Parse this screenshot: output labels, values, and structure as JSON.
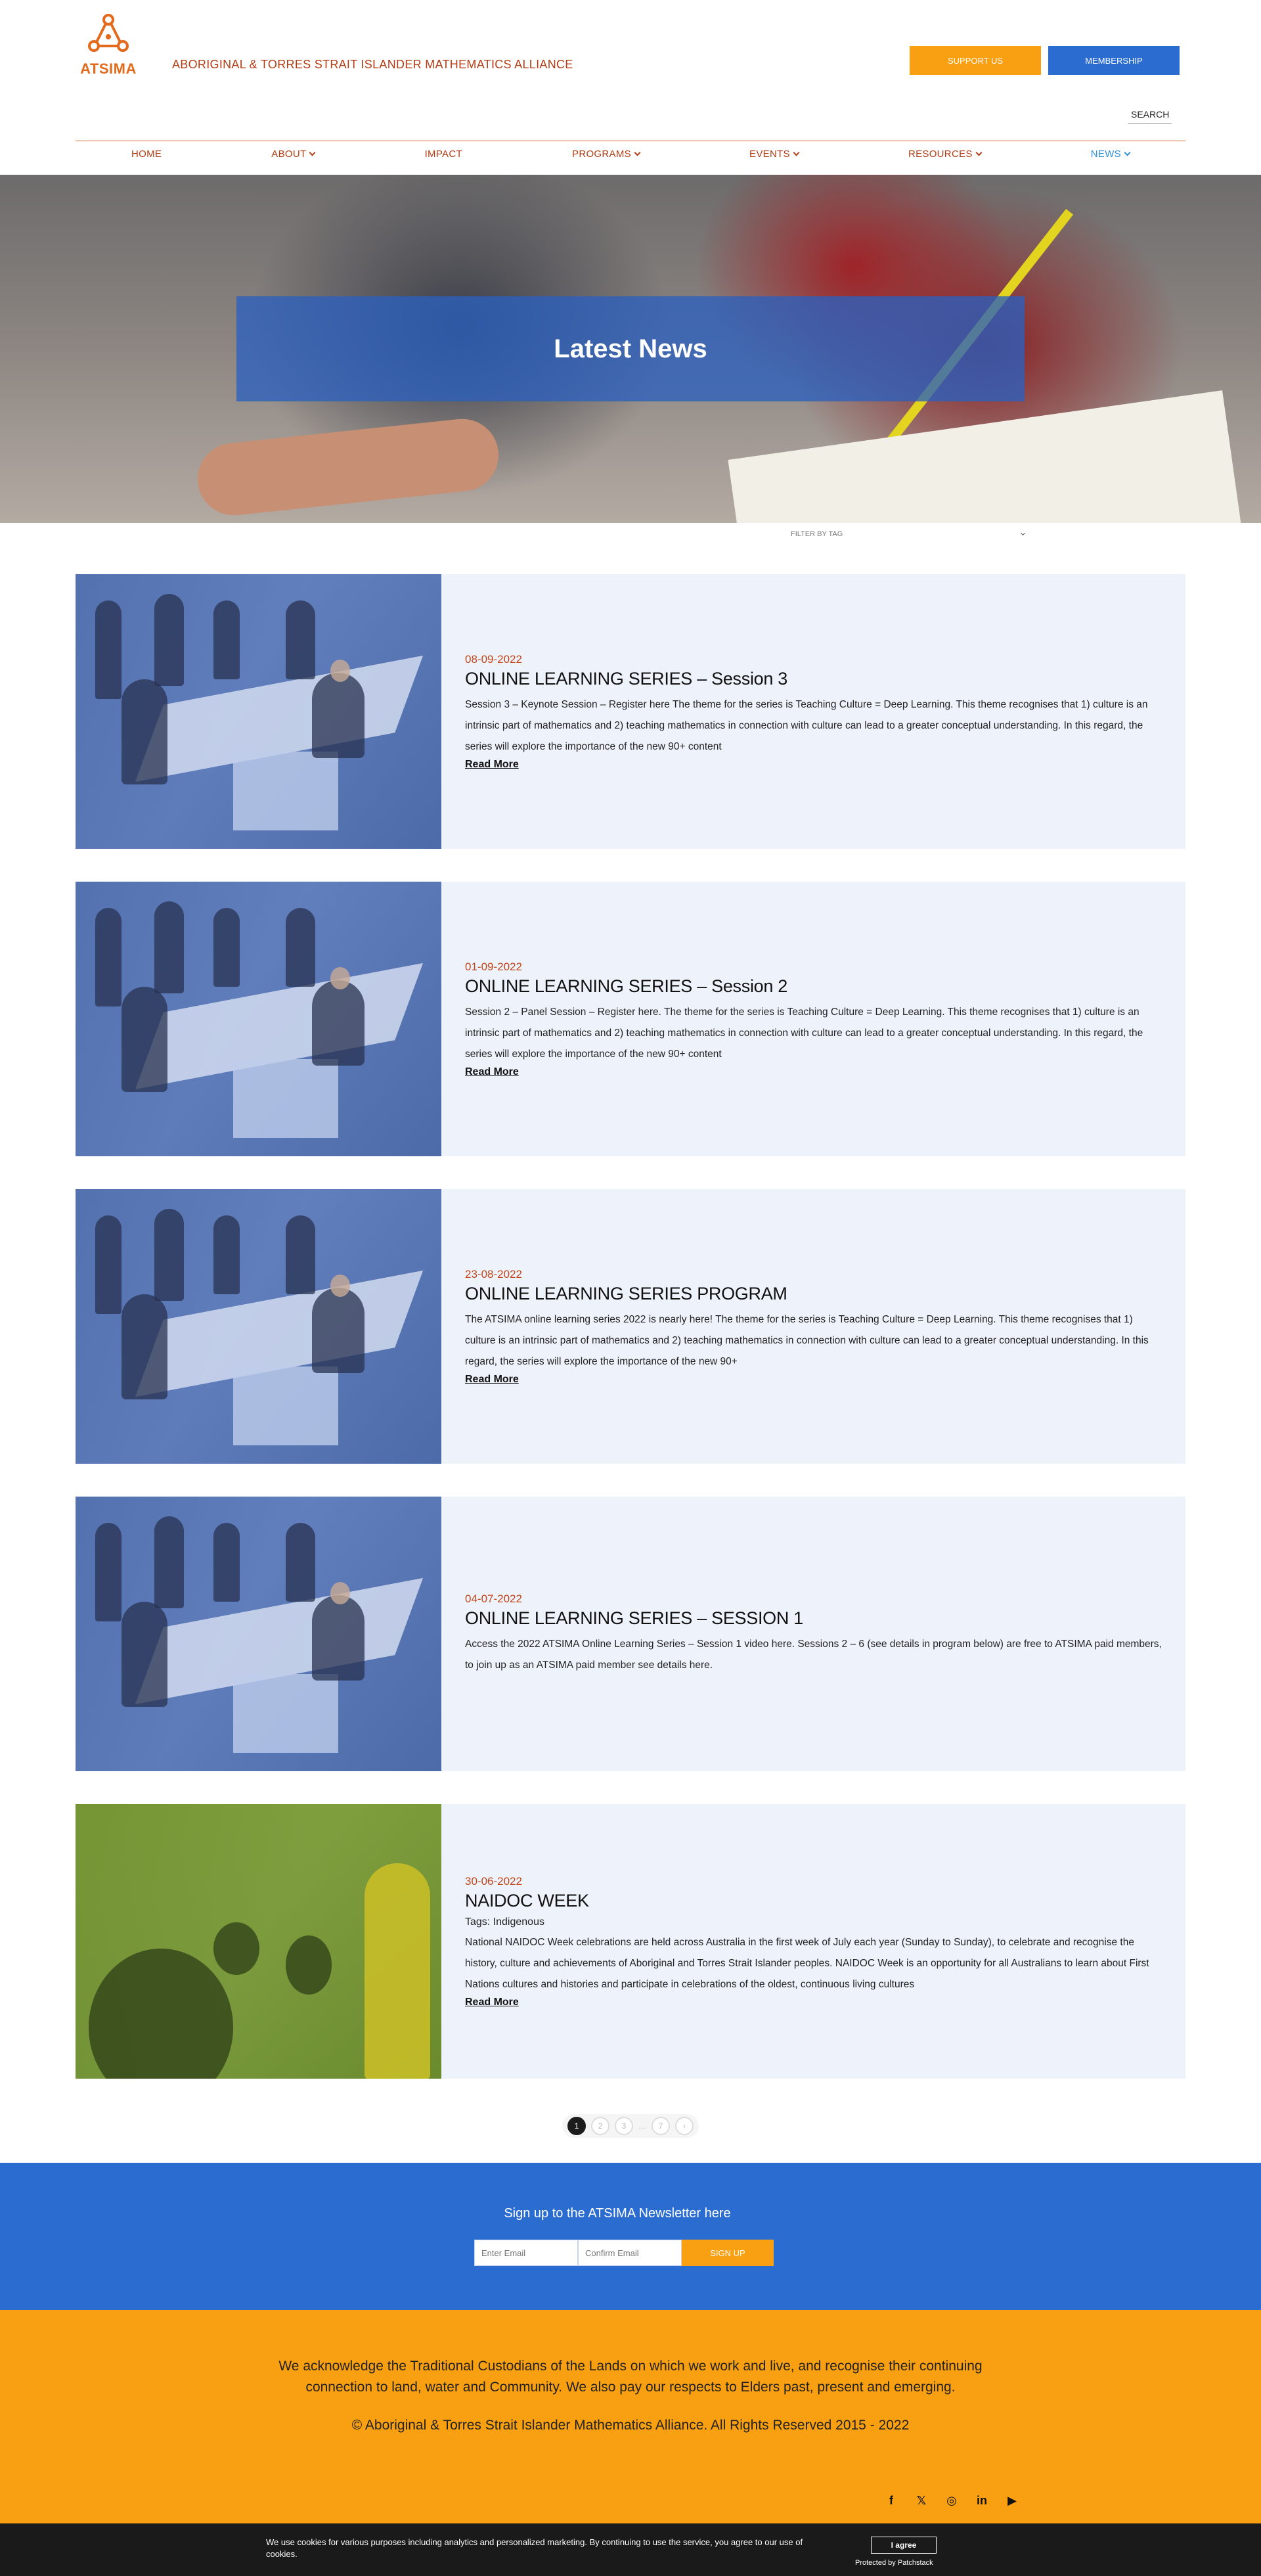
{
  "header": {
    "logo_text": "ATSIMA",
    "org_name": "ABORIGINAL & TORRES STRAIT ISLANDER MATHEMATICS ALLIANCE",
    "support_label": "SUPPORT US",
    "membership_label": "MEMBERSHIP",
    "search_label": "SEARCH"
  },
  "nav": {
    "items": [
      {
        "label": "HOME",
        "dropdown": false
      },
      {
        "label": "ABOUT",
        "dropdown": true
      },
      {
        "label": "IMPACT",
        "dropdown": false
      },
      {
        "label": "PROGRAMS",
        "dropdown": true
      },
      {
        "label": "EVENTS",
        "dropdown": true
      },
      {
        "label": "RESOURCES",
        "dropdown": true
      },
      {
        "label": "NEWS",
        "dropdown": true,
        "active": true
      }
    ]
  },
  "hero": {
    "title": "Latest News"
  },
  "filter": {
    "label": "FILTER BY TAG"
  },
  "posts": [
    {
      "date": "08-09-2022",
      "title": "ONLINE LEARNING SERIES – Session 3",
      "tags": "",
      "excerpt": "Session 3 – Keynote Session – Register here The theme for the series is Teaching Culture = Deep Learning. This theme recognises that 1) culture is an intrinsic part of mathematics and 2) teaching mathematics in connection with culture can lead to a greater conceptual understanding. In this regard, the series will explore the importance of the new 90+ content",
      "read_more": "Read More"
    },
    {
      "date": "01-09-2022",
      "title": "ONLINE LEARNING SERIES – Session 2",
      "tags": "",
      "excerpt": "Session 2 – Panel Session – Register here. The theme for the series is Teaching Culture = Deep Learning. This theme recognises that 1) culture is an intrinsic part of mathematics and 2) teaching mathematics in connection with culture can lead to a greater conceptual understanding. In this regard, the series will explore the importance of the new 90+ content",
      "read_more": "Read More"
    },
    {
      "date": "23-08-2022",
      "title": "ONLINE LEARNING SERIES PROGRAM",
      "tags": "",
      "excerpt": "The ATSIMA online learning series 2022 is nearly here! The theme for the series is Teaching Culture = Deep Learning. This theme recognises that 1) culture is an intrinsic part of mathematics and 2) teaching mathematics in connection with culture can lead to a greater conceptual understanding. In this regard, the series will explore the importance of the new 90+",
      "read_more": "Read More"
    },
    {
      "date": "04-07-2022",
      "title": "ONLINE LEARNING SERIES – SESSION 1",
      "tags": "",
      "excerpt": "Access the 2022 ATSIMA Online Learning Series – Session 1 video here. Sessions 2 – 6 (see details in program below) are free to ATSIMA paid members, to join up as an ATSIMA paid member see details here.",
      "read_more": ""
    },
    {
      "date": "30-06-2022",
      "title": "NAIDOC WEEK",
      "tags": "Tags: Indigenous",
      "excerpt": "National NAIDOC Week celebrations are held across Australia in the first week of July each year (Sunday to Sunday), to celebrate and recognise the history, culture and achievements of Aboriginal and Torres Strait Islander peoples. NAIDOC Week is an opportunity for all Australians to learn about First Nations cultures and histories and participate in celebrations of the oldest, continuous living cultures",
      "read_more": "Read More"
    }
  ],
  "pagination": {
    "pages": [
      "1",
      "2",
      "3",
      "…",
      "7",
      "›"
    ],
    "current": "1"
  },
  "newsletter": {
    "title": "Sign up to the ATSIMA Newsletter here",
    "email_placeholder": "Enter Email",
    "confirm_placeholder": "Confirm Email",
    "signup_label": "SIGN UP"
  },
  "footer": {
    "acknowledgement": "We acknowledge the Traditional Custodians of the Lands on which we work and live, and recognise their continuing connection to land, water and Community. We also pay our respects to Elders past, present and emerging.",
    "copyright": "© Aboriginal & Torres Strait Islander Mathematics Alliance. All Rights Reserved 2015 - 2022",
    "socials": [
      {
        "icon": "facebook-icon",
        "glyph": "f"
      },
      {
        "icon": "twitter-icon",
        "glyph": "𝕏"
      },
      {
        "icon": "instagram-icon",
        "glyph": "◎"
      },
      {
        "icon": "linkedin-icon",
        "glyph": "in"
      },
      {
        "icon": "youtube-icon",
        "glyph": "▶"
      }
    ]
  },
  "cookie": {
    "text": "We use cookies for various purposes including analytics and personalized marketing. By continuing to use the service, you agree to our use of cookies.",
    "agree_label": "I agree",
    "protected_label": "Protected by Patchstack"
  },
  "colors": {
    "accent_orange": "#f9a012",
    "brand_blue": "#2b6cd1",
    "nav_red": "#b23c14",
    "nav_active": "#2b8fd6"
  }
}
